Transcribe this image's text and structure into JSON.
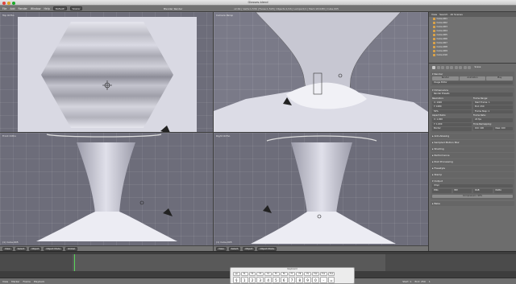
{
  "window": {
    "title": "Glasses.blend"
  },
  "topbar": {
    "menus": [
      "File",
      "Add",
      "Render",
      "Window",
      "Help"
    ],
    "layout": "Default",
    "scene": "Scene",
    "engine": "Blender Render",
    "stats": "v2.64 | Verts:1,536 | Faces:1,528 | Objects:1/16 | Lamps:0/1 | Mem:18.64M | Cube.005"
  },
  "viewports": {
    "tl": {
      "label": "Top Ortho",
      "info": "(1) Cube.005"
    },
    "tr": {
      "label": "Camera Persp",
      "info": "(1) Cube.005"
    },
    "bl": {
      "label": "Front Ortho",
      "info": "(1) Cube.005"
    },
    "br": {
      "label": "Right Ortho",
      "info": "(1) Cube.005"
    },
    "header": {
      "view": "View",
      "select": "Select",
      "object": "Object",
      "mode": "Object Mode",
      "global": "Global"
    }
  },
  "outliner": {
    "header": {
      "view": "View",
      "search": "Search",
      "scope": "All Scenes"
    },
    "items": [
      "Cube.001",
      "Cube.002",
      "Cube.003",
      "Cube.004",
      "Cube.005",
      "Cube.006",
      "Cube.007",
      "Cube.008",
      "Cube.009",
      "Cube.010"
    ]
  },
  "properties": {
    "scene": "Scene",
    "render": {
      "title": "Render",
      "buttons": [
        "Render",
        "Animation",
        "Play"
      ],
      "display": "Image Editor"
    },
    "dimensions": {
      "title": "Dimensions",
      "preset": "Render Presets",
      "res_label": "Resolution:",
      "res_x": "X: 1920",
      "res_y": "Y: 1080",
      "res_pct": "50%",
      "frame_label": "Frame Range:",
      "start": "Start Frame: 1",
      "end": "End: 250",
      "step": "Frame Step: 1",
      "aspect_label": "Aspect Ratio:",
      "aspect_x": "X: 1.000",
      "aspect_y": "Y: 1.000",
      "fps_label": "Frame Rate:",
      "fps": "24 fps",
      "border": "Border",
      "crop": "Crop",
      "time_label": "Time Remapping:",
      "old": "Old: 100",
      "new": "New: 100"
    },
    "closed_sections": [
      "Anti-Aliasing",
      "Sampled Motion Blur",
      "Shading",
      "Performance",
      "Post Processing",
      "Freestyle",
      "Stamp"
    ],
    "output": {
      "title": "Output",
      "path": "/tmp/",
      "format": "PNG",
      "bw": "BW",
      "rgb": "RGB",
      "rgba": "RGBA",
      "compression": "Compression: 90%"
    },
    "bake": "Bake"
  },
  "timeline": {
    "menus": [
      "View",
      "Marker",
      "Frame",
      "Playback"
    ],
    "start": "Start: 1",
    "end": "End: 250",
    "current": "1"
  },
  "keyboard": {
    "title": "Keyboard",
    "fn_keys": [
      "esc",
      "F1",
      "F2",
      "F3",
      "F4",
      "F5",
      "F6",
      "F7",
      "F8",
      "F9",
      "F10",
      "F11",
      "F12"
    ],
    "num_keys": [
      "§",
      "1",
      "2",
      "3",
      "4",
      "5",
      "6",
      "7",
      "8",
      "9",
      "0",
      "-",
      "="
    ]
  }
}
